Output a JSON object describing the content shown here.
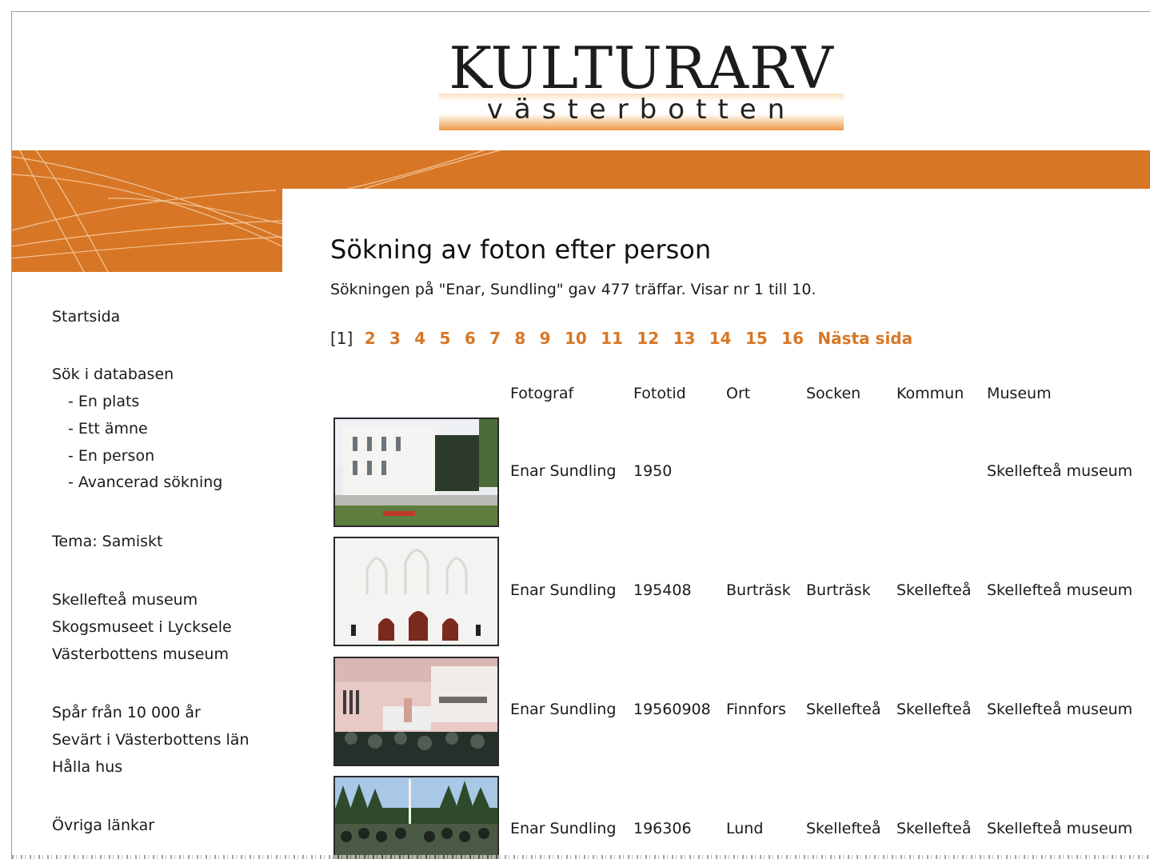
{
  "logo": {
    "title": "KULTURARV",
    "subtitle": "västerbotten"
  },
  "sidebar": {
    "items": [
      {
        "label": "Startsida"
      },
      {
        "label": "Sök i databasen"
      },
      {
        "label": "- En plats"
      },
      {
        "label": "- Ett ämne"
      },
      {
        "label": "- En person"
      },
      {
        "label": "- Avancerad sökning"
      },
      {
        "label": "Tema: Samiskt"
      },
      {
        "label": "Skellefteå museum"
      },
      {
        "label": "Skogsmuseet i Lycksele"
      },
      {
        "label": "Västerbottens museum"
      },
      {
        "label": "Spår från 10 000 år"
      },
      {
        "label": "Sevärt i Västerbottens län"
      },
      {
        "label": "Hålla hus"
      },
      {
        "label": "Övriga länkar"
      }
    ]
  },
  "main": {
    "title": "Sökning av foton efter person",
    "summary": "Sökningen på \"Enar, Sundling\" gav 477 träffar. Visar nr 1 till 10.",
    "pager": {
      "current": "[1]",
      "pages": [
        "2",
        "3",
        "4",
        "5",
        "6",
        "7",
        "8",
        "9",
        "10",
        "11",
        "12",
        "13",
        "14",
        "15",
        "16"
      ],
      "next": "Nästa sida"
    },
    "table": {
      "headers": [
        "Fotograf",
        "Fototid",
        "Ort",
        "Socken",
        "Kommun",
        "Museum"
      ],
      "rows": [
        {
          "fotograf": "Enar Sundling",
          "fototid": "1950",
          "ort": "",
          "socken": "",
          "kommun": "",
          "museum": "Skellefteå museum"
        },
        {
          "fotograf": "Enar Sundling",
          "fototid": "195408",
          "ort": "Burträsk",
          "socken": "Burträsk",
          "kommun": "Skellefteå",
          "museum": "Skellefteå museum"
        },
        {
          "fotograf": "Enar Sundling",
          "fototid": "19560908",
          "ort": "Finnfors",
          "socken": "Skellefteå",
          "kommun": "Skellefteå",
          "museum": "Skellefteå museum"
        },
        {
          "fotograf": "Enar Sundling",
          "fototid": "196306",
          "ort": "Lund",
          "socken": "Skellefteå",
          "kommun": "Skellefteå",
          "museum": "Skellefteå museum"
        }
      ]
    }
  },
  "colors": {
    "accent": "#d77726",
    "text": "#1a1a1a"
  }
}
